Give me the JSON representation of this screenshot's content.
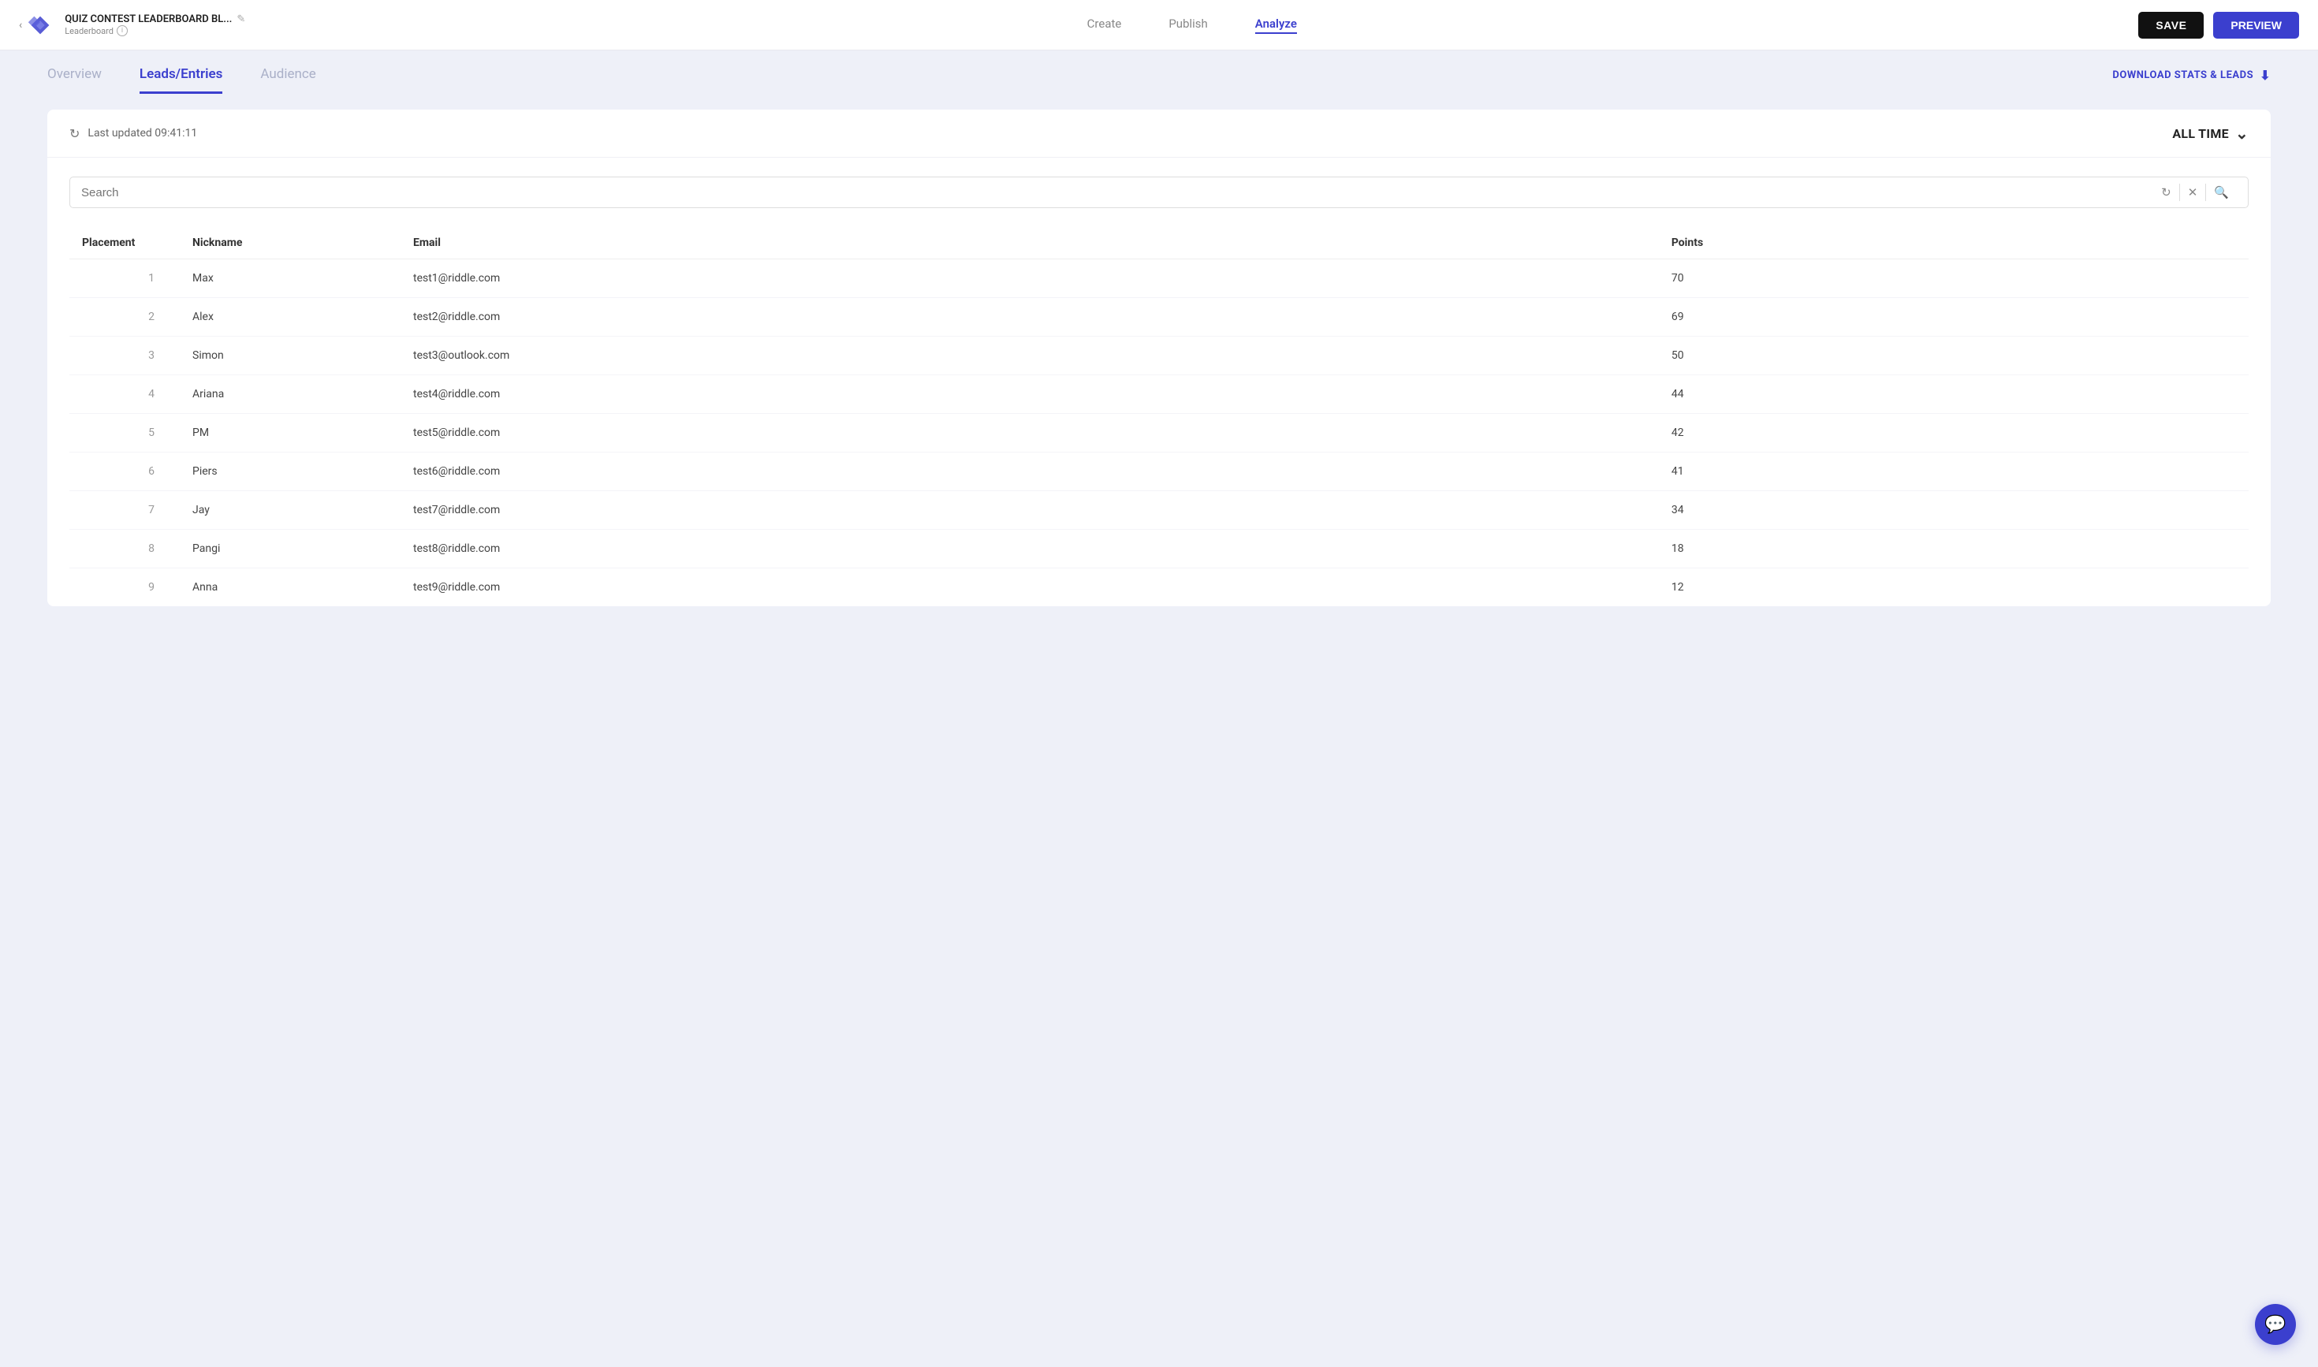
{
  "topbar": {
    "back_chevron": "‹",
    "title": "QUIZ CONTEST LEADERBOARD BL...",
    "subtitle": "Leaderboard",
    "edit_icon": "✎",
    "info_icon": "i",
    "nav": [
      {
        "label": "Create",
        "active": false
      },
      {
        "label": "Publish",
        "active": false
      },
      {
        "label": "Analyze",
        "active": true
      }
    ],
    "save_label": "SAVE",
    "preview_label": "PREVIEW"
  },
  "secondary_nav": {
    "tabs": [
      {
        "label": "Overview",
        "active": false
      },
      {
        "label": "Leads/Entries",
        "active": true
      },
      {
        "label": "Audience",
        "active": false
      }
    ],
    "download_label": "DOWNLOAD STATS & LEADS"
  },
  "time_filter": {
    "refresh_text": "Last updated 09:41:11",
    "time_label": "ALL TIME"
  },
  "search": {
    "placeholder": "Search"
  },
  "table": {
    "columns": [
      "Placement",
      "Nickname",
      "Email",
      "Points"
    ],
    "rows": [
      {
        "placement": "1",
        "nickname": "Max",
        "email": "test1@riddle.com",
        "points": "70"
      },
      {
        "placement": "2",
        "nickname": "Alex",
        "email": "test2@riddle.com",
        "points": "69"
      },
      {
        "placement": "3",
        "nickname": "Simon",
        "email": "test3@outlook.com",
        "points": "50"
      },
      {
        "placement": "4",
        "nickname": "Ariana",
        "email": "test4@riddle.com",
        "points": "44"
      },
      {
        "placement": "5",
        "nickname": "PM",
        "email": "test5@riddle.com",
        "points": "42"
      },
      {
        "placement": "6",
        "nickname": "Piers",
        "email": "test6@riddle.com",
        "points": "41"
      },
      {
        "placement": "7",
        "nickname": "Jay",
        "email": "test7@riddle.com",
        "points": "34"
      },
      {
        "placement": "8",
        "nickname": "Pangi",
        "email": "test8@riddle.com",
        "points": "18"
      },
      {
        "placement": "9",
        "nickname": "Anna",
        "email": "test9@riddle.com",
        "points": "12"
      }
    ]
  },
  "colors": {
    "accent": "#3b3fce",
    "bg": "#eef0f8"
  }
}
